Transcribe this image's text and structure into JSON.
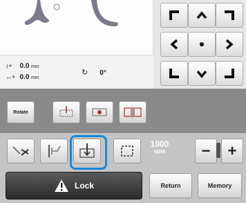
{
  "position": {
    "y_value": "0.0",
    "x_value": "0.0",
    "unit": "mm",
    "angle": "0°"
  },
  "edit_buttons": {
    "rotate_label": "Rotate"
  },
  "speed": {
    "value": "1000",
    "unit": "spm"
  },
  "bottom": {
    "lock_label": "Lock",
    "return_label": "Return",
    "memory_label": "Memory"
  },
  "colors": {
    "selection_accent": "#1a88d8",
    "stitch_preview": "#7a7a8c"
  }
}
